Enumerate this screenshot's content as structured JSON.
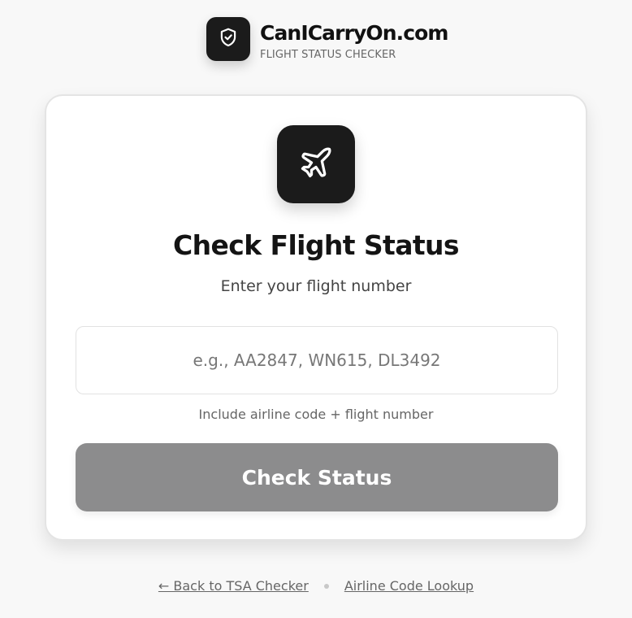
{
  "brand": {
    "name": "CanICarryOn.com",
    "subtitle": "FLIGHT STATUS CHECKER",
    "logo_icon": "shield-check-icon"
  },
  "card": {
    "icon": "airplane-icon",
    "title": "Check Flight Status",
    "subtitle": "Enter your flight number",
    "flight_input": {
      "value": "",
      "placeholder": "e.g., AA2847, WN615, DL3492"
    },
    "hint": "Include airline code + flight number",
    "submit_label": "Check Status"
  },
  "footer": {
    "back_link": "← Back to TSA Checker",
    "lookup_link": "Airline Code Lookup"
  },
  "colors": {
    "background": "#f8f8f8",
    "dark_icon_bg": "#1b1b1b",
    "button_disabled": "#8c8c8d"
  }
}
